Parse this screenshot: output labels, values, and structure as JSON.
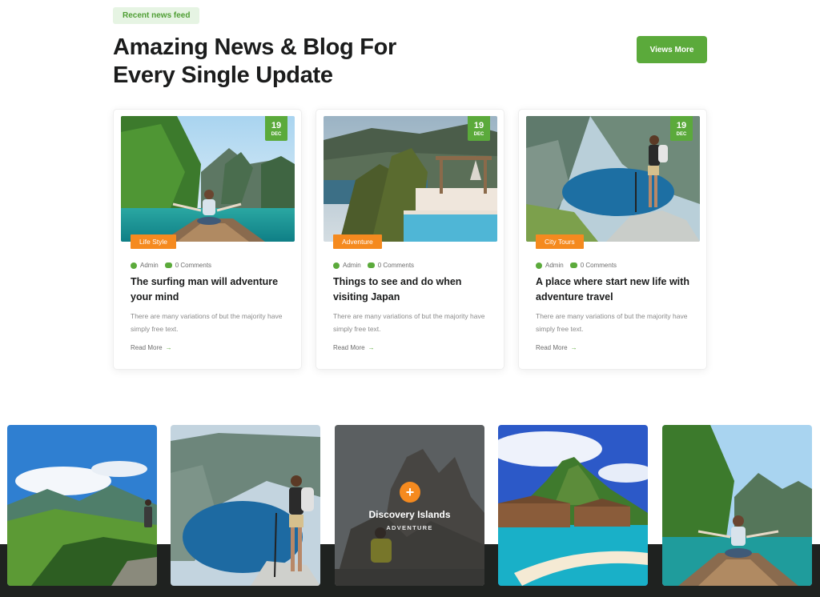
{
  "header": {
    "badge": "Recent news feed",
    "title": "Amazing News & Blog For Every Single Update",
    "button": "Views More"
  },
  "posts": [
    {
      "day": "19",
      "month": "DEC",
      "category": "Life Style",
      "author": "Admin",
      "comments": "0 Comments",
      "title": "The surfing man will adventure your mind",
      "excerpt": "There are many variations of but the majority have simply free text.",
      "read_more": "Read More",
      "image": "woman-on-boat-lagoon"
    },
    {
      "day": "19",
      "month": "DEC",
      "category": "Adventure",
      "author": "Admin",
      "comments": "0 Comments",
      "title": "Things to see and do when visiting Japan",
      "excerpt": "There are many variations of but the majority have simply free text.",
      "read_more": "Read More",
      "image": "resort-pool-pergola"
    },
    {
      "day": "19",
      "month": "DEC",
      "category": "City Tours",
      "author": "Admin",
      "comments": "0 Comments",
      "title": "A place where start new life with adventure travel",
      "excerpt": "There are many variations of but the majority have simply free text.",
      "read_more": "Read More",
      "image": "hiker-fjord-lake"
    }
  ],
  "gallery": [
    {
      "image": "mountain-meadow-hiker"
    },
    {
      "image": "hiker-fjord-lake"
    },
    {
      "image": "rocky-peaks",
      "title": "Discovery Islands",
      "subtitle": "ADVENTURE"
    },
    {
      "image": "tropical-island-bungalows"
    },
    {
      "image": "woman-on-boat-lagoon"
    }
  ],
  "colors": {
    "accent_green": "#5baa3b",
    "accent_orange": "#f58a1f",
    "dark_band": "#1f2220"
  }
}
